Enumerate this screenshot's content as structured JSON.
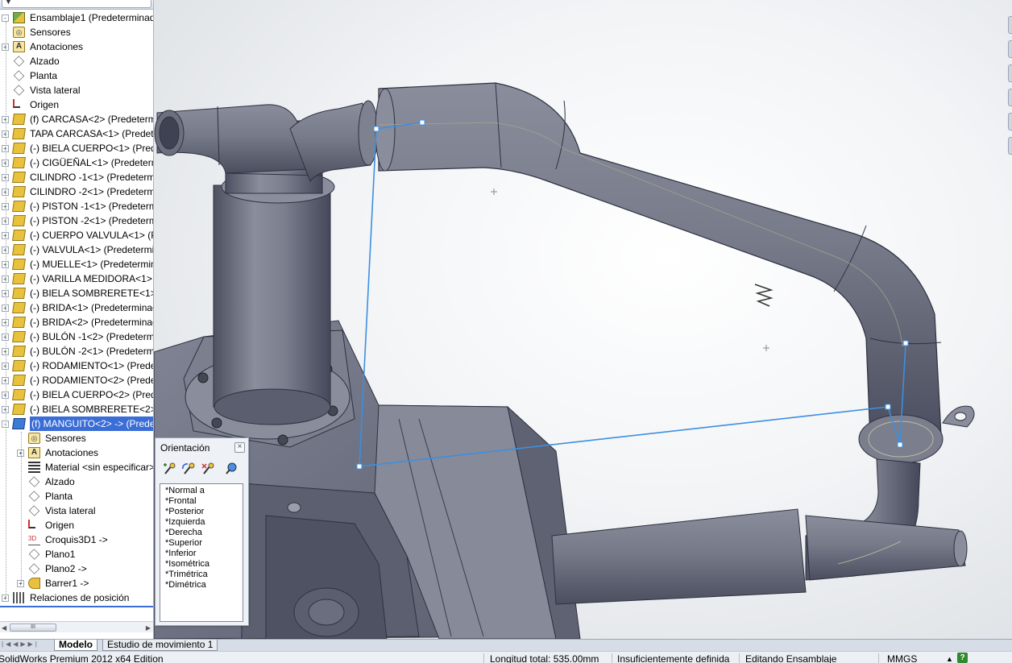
{
  "tree": {
    "items": [
      {
        "label": "Ensamblaje1  (Predeterminado",
        "icon": "assembly-icon",
        "level": 0,
        "expander": "-"
      },
      {
        "label": "Sensores",
        "icon": "sensors-icon",
        "level": 0,
        "expander": ""
      },
      {
        "label": "Anotaciones",
        "icon": "annotations-icon",
        "level": 0,
        "expander": "+"
      },
      {
        "label": "Alzado",
        "icon": "plane-icon",
        "level": 0,
        "expander": ""
      },
      {
        "label": "Planta",
        "icon": "plane-icon",
        "level": 0,
        "expander": ""
      },
      {
        "label": "Vista lateral",
        "icon": "plane-icon",
        "level": 0,
        "expander": ""
      },
      {
        "label": "Origen",
        "icon": "origin-icon",
        "level": 0,
        "expander": ""
      },
      {
        "label": "(f) CARCASA<2> (Predeterm",
        "icon": "part-icon",
        "level": 0,
        "expander": "+"
      },
      {
        "label": "TAPA CARCASA<1> (Predete",
        "icon": "part-icon",
        "level": 0,
        "expander": "+"
      },
      {
        "label": "(-) BIELA CUERPO<1> (Prede",
        "icon": "part-icon",
        "level": 0,
        "expander": "+"
      },
      {
        "label": "(-) CIGÜEÑAL<1> (Predeterm",
        "icon": "part-icon",
        "level": 0,
        "expander": "+"
      },
      {
        "label": "CILINDRO -1<1> (Predeterm",
        "icon": "part-icon",
        "level": 0,
        "expander": "+"
      },
      {
        "label": "CILINDRO -2<1> (Predeterm",
        "icon": "part-icon",
        "level": 0,
        "expander": "+"
      },
      {
        "label": "(-) PISTON -1<1> (Predeterm",
        "icon": "part-icon",
        "level": 0,
        "expander": "+"
      },
      {
        "label": "(-) PISTON -2<1> (Predeterm",
        "icon": "part-icon",
        "level": 0,
        "expander": "+"
      },
      {
        "label": "(-) CUERPO VALVULA<1> (Pr",
        "icon": "part-icon",
        "level": 0,
        "expander": "+"
      },
      {
        "label": "(-) VALVULA<1> (Predetermi",
        "icon": "part-icon",
        "level": 0,
        "expander": "+"
      },
      {
        "label": "(-) MUELLE<1> (Predetermin",
        "icon": "part-icon",
        "level": 0,
        "expander": "+"
      },
      {
        "label": "(-) VARILLA MEDIDORA<1> (",
        "icon": "part-icon",
        "level": 0,
        "expander": "+"
      },
      {
        "label": "(-) BIELA SOMBRERETE<1> (I",
        "icon": "part-icon",
        "level": 0,
        "expander": "+"
      },
      {
        "label": "(-) BRIDA<1> (Predeterminac",
        "icon": "part-icon",
        "level": 0,
        "expander": "+"
      },
      {
        "label": "(-) BRIDA<2> (Predeterminac",
        "icon": "part-icon",
        "level": 0,
        "expander": "+"
      },
      {
        "label": "(-) BULÓN -1<2> (Predeterm",
        "icon": "part-icon",
        "level": 0,
        "expander": "+"
      },
      {
        "label": "(-) BULÓN -2<1> (Predeterm",
        "icon": "part-icon",
        "level": 0,
        "expander": "+"
      },
      {
        "label": "(-) RODAMIENTO<1> (Prede",
        "icon": "part-icon",
        "level": 0,
        "expander": "+"
      },
      {
        "label": "(-) RODAMIENTO<2> (Prede",
        "icon": "part-icon",
        "level": 0,
        "expander": "+"
      },
      {
        "label": "(-) BIELA CUERPO<2> (Prede",
        "icon": "part-icon",
        "level": 0,
        "expander": "+"
      },
      {
        "label": "(-) BIELA SOMBRERETE<2> (I",
        "icon": "part-icon",
        "level": 0,
        "expander": "+"
      },
      {
        "label": "(f) MANGUITO<2> -> (Prede",
        "icon": "part-selected-icon",
        "level": 0,
        "expander": "-",
        "selected": true
      },
      {
        "label": "Sensores",
        "icon": "sensors-icon",
        "level": 1,
        "expander": ""
      },
      {
        "label": "Anotaciones",
        "icon": "annotations-icon",
        "level": 1,
        "expander": "+"
      },
      {
        "label": "Material <sin especificar>",
        "icon": "material-icon",
        "level": 1,
        "expander": ""
      },
      {
        "label": "Alzado",
        "icon": "plane-icon",
        "level": 1,
        "expander": ""
      },
      {
        "label": "Planta",
        "icon": "plane-icon",
        "level": 1,
        "expander": ""
      },
      {
        "label": "Vista lateral",
        "icon": "plane-icon",
        "level": 1,
        "expander": ""
      },
      {
        "label": "Origen",
        "icon": "origin-icon",
        "level": 1,
        "expander": ""
      },
      {
        "label": "Croquis3D1 ->",
        "icon": "sketch3d-icon",
        "level": 1,
        "expander": ""
      },
      {
        "label": "Plano1",
        "icon": "plane-icon",
        "level": 1,
        "expander": ""
      },
      {
        "label": "Plano2 ->",
        "icon": "plane-icon",
        "level": 1,
        "expander": ""
      },
      {
        "label": "Barrer1 ->",
        "icon": "sweep-icon",
        "level": 1,
        "expander": "+"
      },
      {
        "label": "Relaciones de posición",
        "icon": "mates-icon",
        "level": 0,
        "expander": "+"
      }
    ],
    "scroll_thumb": "III"
  },
  "orientation": {
    "title": "Orientación",
    "tools": [
      "new-view-icon",
      "update-view-icon",
      "reset-views-icon",
      "pin-dialog-icon"
    ],
    "items": [
      "*Normal a",
      "*Frontal",
      "*Posterior",
      "*Izquierda",
      "*Derecha",
      "*Superior",
      "*Inferior",
      "*Isométrica",
      "*Trimétrica",
      "*Dimétrica"
    ]
  },
  "tabs": {
    "items": [
      "Modelo",
      "Estudio de movimiento 1"
    ],
    "active": "Modelo"
  },
  "status": {
    "product": "SolidWorks Premium 2012 x64 Edition",
    "length": "Longitud total: 535.00mm",
    "definition": "Insuficientemente definida",
    "mode": "Editando Ensamblaje",
    "units": "MMGS",
    "help": "?"
  },
  "colors": {
    "model_body": "#6f7383",
    "sketch_line": "#3d8fe0",
    "selection": "#3b6dd6"
  }
}
